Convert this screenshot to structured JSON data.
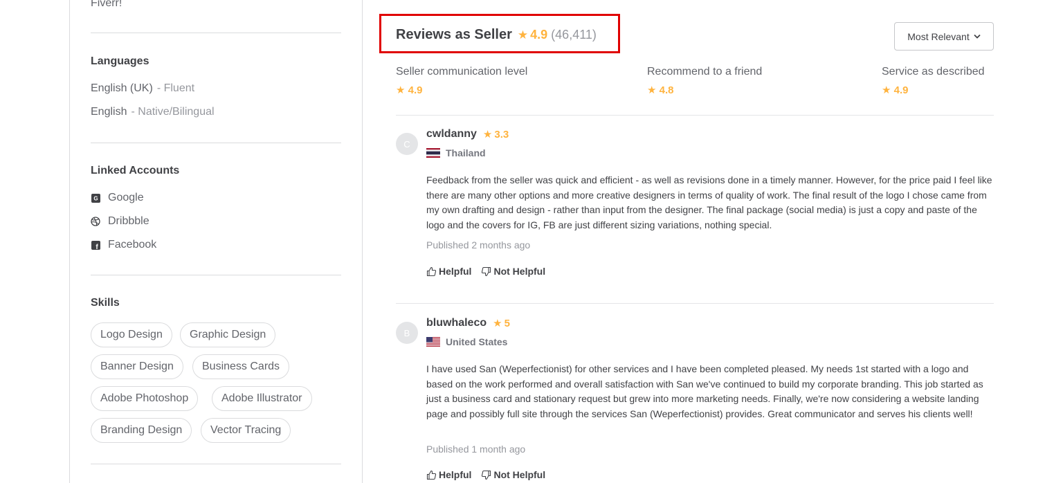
{
  "sidebar": {
    "description_tail": "Fiverr!",
    "languages": {
      "title": "Languages",
      "items": [
        {
          "name": "English (UK)",
          "level": "- Fluent"
        },
        {
          "name": "English",
          "level": "- Native/Bilingual"
        }
      ]
    },
    "linked_accounts": {
      "title": "Linked Accounts",
      "items": [
        {
          "label": "Google",
          "icon": "google-icon"
        },
        {
          "label": "Dribbble",
          "icon": "dribbble-icon"
        },
        {
          "label": "Facebook",
          "icon": "facebook-icon"
        }
      ]
    },
    "skills": {
      "title": "Skills",
      "items": [
        "Logo Design",
        "Graphic Design",
        "Banner Design",
        "Business Cards",
        "Adobe Photoshop",
        "Adobe Illustrator",
        "Branding Design",
        "Vector Tracing"
      ]
    }
  },
  "reviews": {
    "title": "Reviews as Seller",
    "rating": "4.9",
    "count": "(46,411)",
    "sort": {
      "selected": "Most Relevant"
    },
    "criteria": [
      {
        "label": "Seller communication level",
        "value": "4.9"
      },
      {
        "label": "Recommend to a friend",
        "value": "4.8"
      },
      {
        "label": "Service as described",
        "value": "4.9"
      }
    ],
    "items": [
      {
        "avatar_letter": "C",
        "username": "cwldanny",
        "score": "3.3",
        "country": "Thailand",
        "text": "Feedback from the seller was quick and efficient - as well as revisions done in a timely manner. However, for the price paid I feel like there are many other options and more creative designers in terms of quality of work. The final result of the logo I chose came from my own drafting and design - rather than input from the designer. The final package (social media) is just a copy and paste of the logo and the covers for IG, FB are just different sizing variations, nothing special.",
        "published": "Published 2 months ago",
        "helpful": "Helpful",
        "not_helpful": "Not Helpful"
      },
      {
        "avatar_letter": "B",
        "username": "bluwhaleco",
        "score": "5",
        "country": "United States",
        "text": "I have used San (Weperfectionist) for other services and I have been completed pleased. My needs 1st started with a logo and based on the work performed and overall satisfaction with San we've continued to build my corporate branding. This job started as just a business card and stationary request but grew into more marketing needs. Finally, we're now considering a website landing page and possibly full site through the services San (Weperfectionist) provides. Great communicator and serves his clients well!",
        "published": "Published 1 month ago",
        "helpful": "Helpful",
        "not_helpful": "Not Helpful"
      }
    ]
  },
  "colors": {
    "accent_star": "#ffb33e",
    "highlight_box": "#e00000",
    "border": "#dadbdd"
  }
}
